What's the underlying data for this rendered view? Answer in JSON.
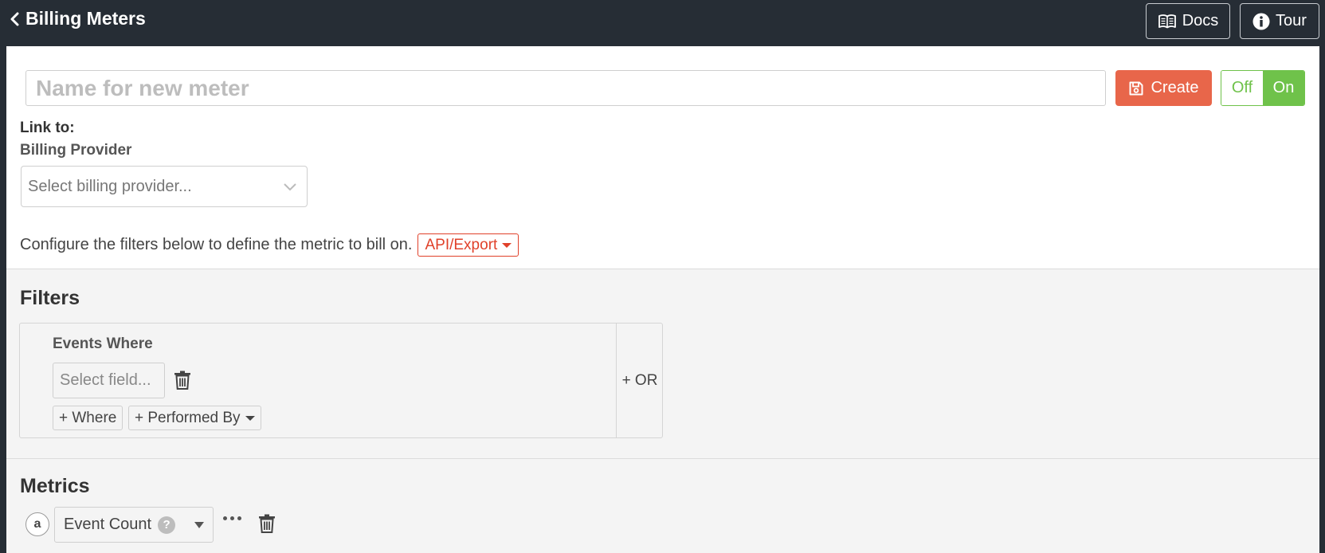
{
  "header": {
    "title": "Billing Meters",
    "docs_label": "Docs",
    "tour_label": "Tour"
  },
  "meter": {
    "name_placeholder": "Name for new meter",
    "create_label": "Create",
    "toggle": {
      "off_label": "Off",
      "on_label": "On",
      "active": "On"
    }
  },
  "link": {
    "link_to_label": "Link to:",
    "provider_label": "Billing Provider",
    "provider_placeholder": "Select billing provider..."
  },
  "configure": {
    "text": "Configure the filters below to define the metric to bill on.",
    "dropdown_label": "API/Export"
  },
  "filters": {
    "title": "Filters",
    "group_label": "Events Where",
    "field_placeholder": "Select field...",
    "where_button": "+ Where",
    "performed_by_button": "+ Performed By",
    "or_button": "+ OR"
  },
  "metrics": {
    "title": "Metrics",
    "items": [
      {
        "letter": "a",
        "label": "Event Count",
        "help": "?"
      }
    ]
  },
  "colors": {
    "topbar_bg": "#262d35",
    "create_bg": "#e8664a",
    "toggle_green": "#6fc24a",
    "api_export_red": "#e0412a",
    "section_bg": "#f4f4f4"
  },
  "icons": {
    "back": "chevron-left-icon",
    "docs": "book-icon",
    "tour": "info-icon",
    "create": "save-icon",
    "provider_dropdown": "chevron-down-icon",
    "delete": "trash-icon",
    "more": "more-horizontal-icon",
    "help": "question-icon"
  }
}
